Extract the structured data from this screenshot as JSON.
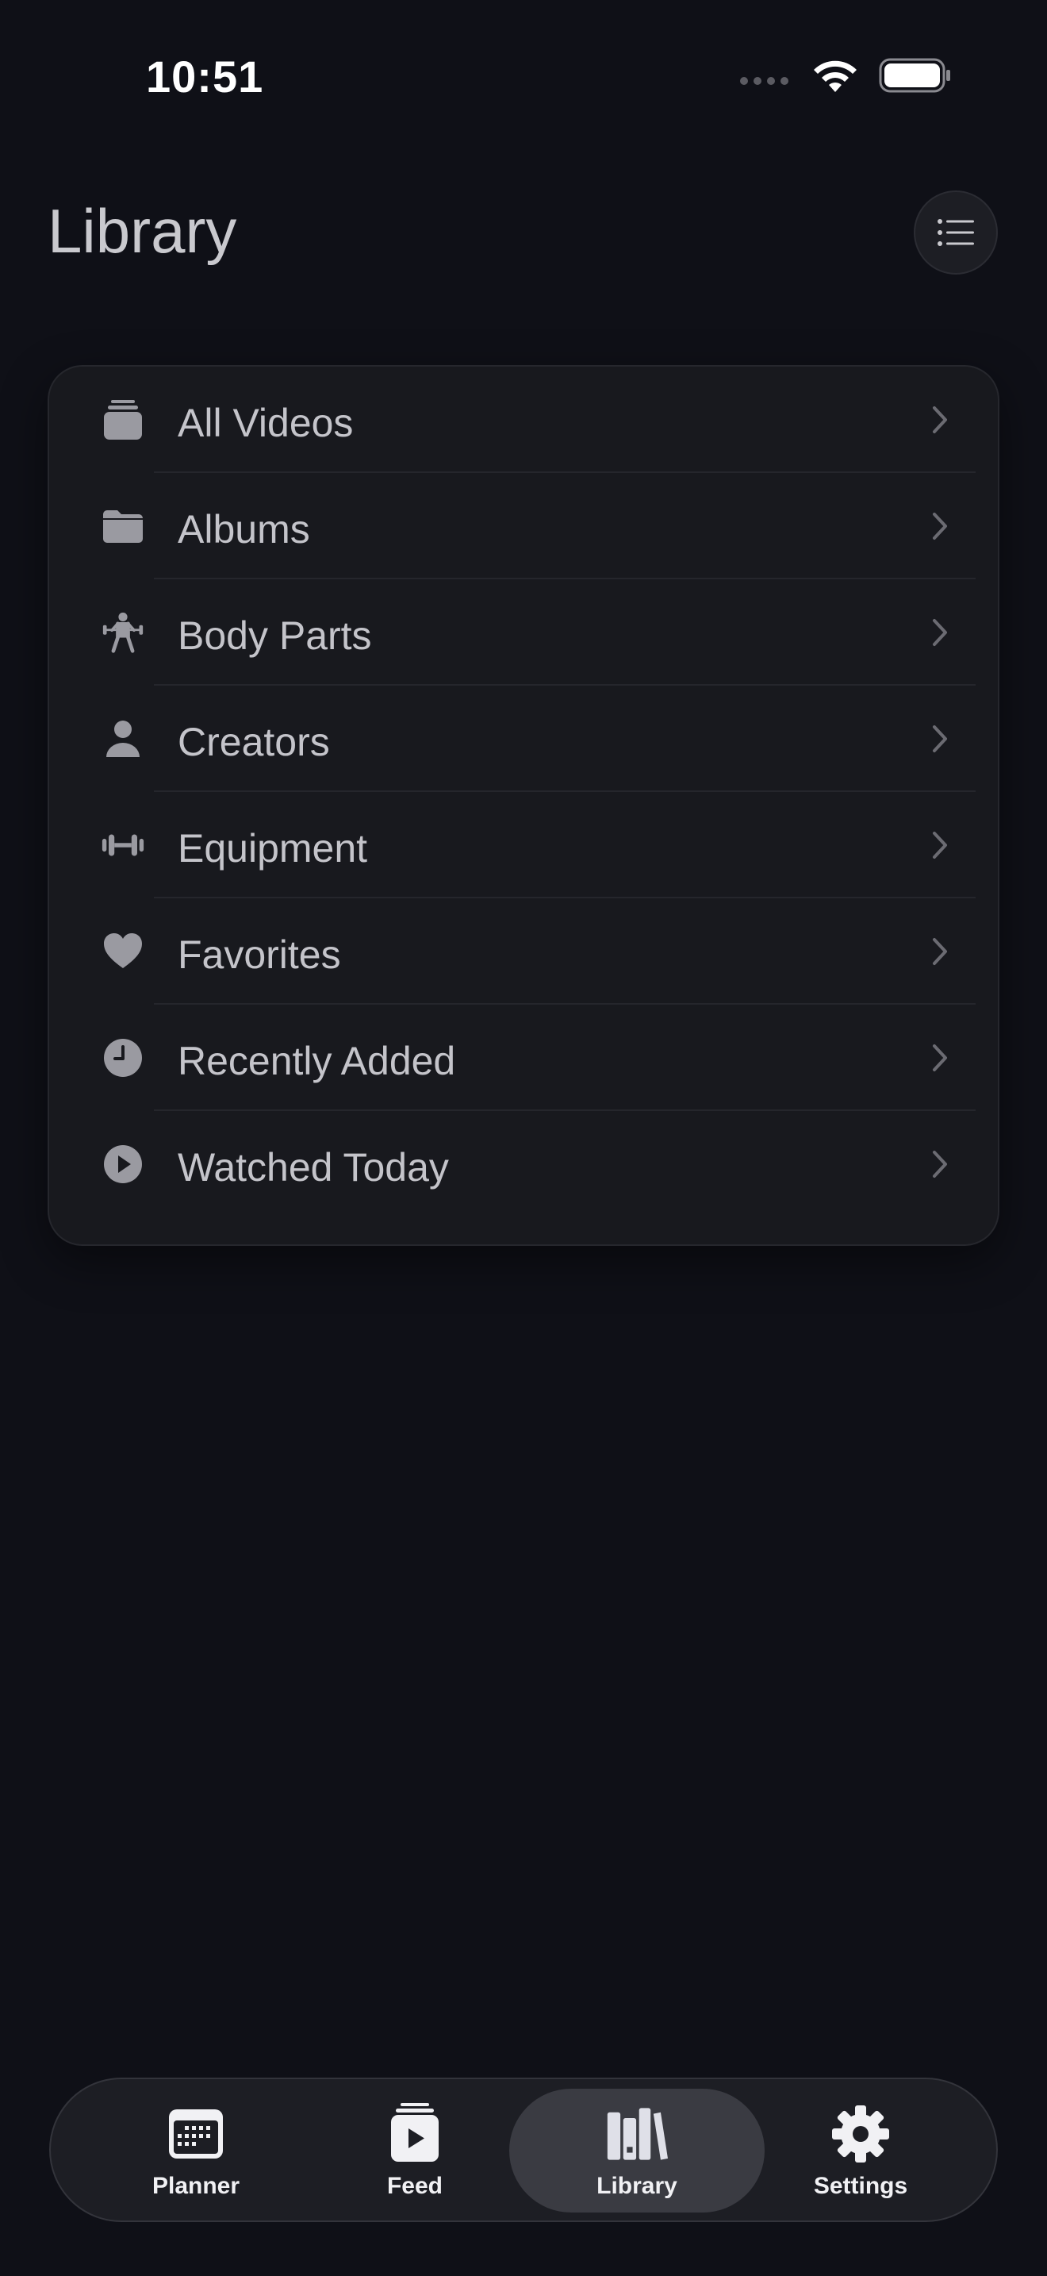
{
  "status_bar": {
    "time": "10:51"
  },
  "header": {
    "title": "Library",
    "menu_icon": "list-bullet-icon"
  },
  "library": {
    "items": [
      {
        "label": "All Videos",
        "icon": "stack-icon"
      },
      {
        "label": "Albums",
        "icon": "folder-icon"
      },
      {
        "label": "Body Parts",
        "icon": "weightlifter-icon"
      },
      {
        "label": "Creators",
        "icon": "person-icon"
      },
      {
        "label": "Equipment",
        "icon": "dumbbell-icon"
      },
      {
        "label": "Favorites",
        "icon": "heart-icon"
      },
      {
        "label": "Recently Added",
        "icon": "clock-icon"
      },
      {
        "label": "Watched Today",
        "icon": "play-circle-icon"
      }
    ]
  },
  "tab_bar": {
    "tabs": [
      {
        "label": "Planner",
        "icon": "calendar-icon"
      },
      {
        "label": "Feed",
        "icon": "video-stack-icon"
      },
      {
        "label": "Library",
        "icon": "books-icon",
        "active": true
      },
      {
        "label": "Settings",
        "icon": "gear-icon"
      }
    ]
  },
  "colors": {
    "background": "#0f1017",
    "card": "#18191e",
    "active_tab": "#3a3b42"
  }
}
